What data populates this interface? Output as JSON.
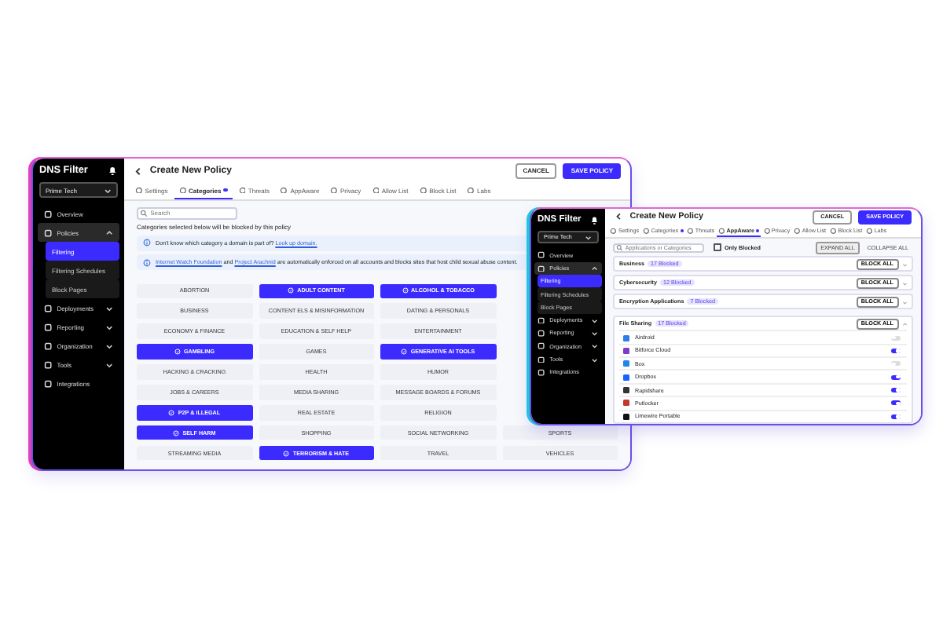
{
  "windows": [
    {
      "sidebar": {
        "logo": "DNS Filter",
        "org": "Prime Tech",
        "items": [
          {
            "label": "Overview",
            "selected": false
          },
          {
            "label": "Policies",
            "selected": false,
            "expanded": true,
            "children": [
              {
                "label": "Filtering",
                "selected": true
              },
              {
                "label": "Filtering Schedules",
                "selected": false
              },
              {
                "label": "Block Pages",
                "selected": false
              }
            ]
          },
          {
            "label": "Deployments",
            "selected": false,
            "expanded": false
          },
          {
            "label": "Reporting",
            "selected": false,
            "expanded": false
          },
          {
            "label": "Organization",
            "selected": false,
            "expanded": false
          },
          {
            "label": "Tools",
            "selected": false,
            "expanded": false
          },
          {
            "label": "Integrations",
            "selected": false
          }
        ]
      },
      "header": {
        "title": "Create New Policy",
        "buttons": [
          {
            "label": "CANCEL",
            "kind": "secondary"
          },
          {
            "label": "SAVE POLICY",
            "kind": "primary"
          }
        ]
      },
      "tabs": [
        {
          "label": "Settings",
          "selected": false,
          "dot": false
        },
        {
          "label": "Categories",
          "selected": true,
          "dot": true
        },
        {
          "label": "Threats",
          "selected": false,
          "dot": false
        },
        {
          "label": "AppAware",
          "selected": false,
          "dot": false
        },
        {
          "label": "Privacy",
          "selected": false,
          "dot": false
        },
        {
          "label": "Allow List",
          "selected": false,
          "dot": false
        },
        {
          "label": "Block List",
          "selected": false,
          "dot": false
        },
        {
          "label": "Labs",
          "selected": false,
          "dot": false
        }
      ],
      "body": {
        "kind": "categories",
        "search": {
          "placeholder": "Search"
        },
        "note": "Categories selected below will be blocked by this policy",
        "notices": [
          [
            {
              "text": "Don't know which category a domain is part of? ",
              "link": false
            },
            {
              "text": "Look up domain.",
              "link": true
            }
          ],
          [
            {
              "text": "Internet Watch Foundation",
              "link": true
            },
            {
              "text": " and ",
              "link": false
            },
            {
              "text": "Project Arachnid",
              "link": true
            },
            {
              "text": " are automatically enforced on all accounts and blocks sites that host child sexual abuse content.",
              "link": false
            }
          ]
        ],
        "category_rows": [
          [
            {
              "label": "ABORTION",
              "selected": false
            },
            {
              "label": "ADULT CONTENT",
              "selected": true
            },
            {
              "label": "ALCOHOL & TOBACCO",
              "selected": true
            }
          ],
          [
            {
              "label": "BUSINESS",
              "selected": false
            },
            {
              "label": "CONTENT ELS & MISINFORMATION",
              "selected": false
            },
            {
              "label": "DATING & PERSONALS",
              "selected": false
            }
          ],
          [
            {
              "label": "ECONOMY & FINANCE",
              "selected": false
            },
            {
              "label": "EDUCATION & SELF HELP",
              "selected": false
            },
            {
              "label": "ENTERTAINMENT",
              "selected": false
            }
          ],
          [
            {
              "label": "GAMBLING",
              "selected": true
            },
            {
              "label": "GAMES",
              "selected": false
            },
            {
              "label": "GENERATIVE AI TOOLS",
              "selected": true
            }
          ],
          [
            {
              "label": "HACKING & CRACKING",
              "selected": false
            },
            {
              "label": "HEALTH",
              "selected": false
            },
            {
              "label": "HUMOR",
              "selected": false
            }
          ],
          [
            {
              "label": "JOBS & CAREERS",
              "selected": false
            },
            {
              "label": "MEDIA SHARING",
              "selected": false
            },
            {
              "label": "MESSAGE BOARDS & FORUMS",
              "selected": false
            }
          ],
          [
            {
              "label": "P2P & ILLEGAL",
              "selected": true
            },
            {
              "label": "REAL ESTATE",
              "selected": false
            },
            {
              "label": "RELIGION",
              "selected": false
            }
          ],
          [
            {
              "label": "SELF HARM",
              "selected": true
            },
            {
              "label": "SHOPPING",
              "selected": false
            },
            {
              "label": "SOCIAL NETWORKING",
              "selected": false
            },
            {
              "label": "SPORTS",
              "selected": false
            }
          ],
          [
            {
              "label": "STREAMING MEDIA",
              "selected": false
            },
            {
              "label": "TERRORISM & HATE",
              "selected": true
            },
            {
              "label": "TRAVEL",
              "selected": false
            },
            {
              "label": "VEHICLES",
              "selected": false
            }
          ]
        ]
      }
    },
    {
      "sidebar": {
        "logo": "DNS Filter",
        "org": "Prime Tech",
        "items": [
          {
            "label": "Overview",
            "selected": false
          },
          {
            "label": "Policies",
            "selected": false,
            "expanded": true,
            "children": [
              {
                "label": "Filtering",
                "selected": true
              },
              {
                "label": "Filtering Schedules",
                "selected": false
              },
              {
                "label": "Block Pages",
                "selected": false
              }
            ]
          },
          {
            "label": "Deployments",
            "selected": false,
            "expanded": false
          },
          {
            "label": "Reporting",
            "selected": false,
            "expanded": false
          },
          {
            "label": "Organization",
            "selected": false,
            "expanded": false
          },
          {
            "label": "Tools",
            "selected": false,
            "expanded": false
          },
          {
            "label": "Integrations",
            "selected": false
          }
        ]
      },
      "header": {
        "title": "Create New Policy",
        "buttons": [
          {
            "label": "CANCEL",
            "kind": "secondary"
          },
          {
            "label": "SAVE POLICY",
            "kind": "primary"
          }
        ]
      },
      "tabs": [
        {
          "label": "Settings",
          "selected": false,
          "dot": false
        },
        {
          "label": "Categories",
          "selected": false,
          "dot": true
        },
        {
          "label": "Threats",
          "selected": false,
          "dot": false
        },
        {
          "label": "AppAware",
          "selected": true,
          "dot": true
        },
        {
          "label": "Privacy",
          "selected": false,
          "dot": false
        },
        {
          "label": "Allow List",
          "selected": false,
          "dot": false
        },
        {
          "label": "Block List",
          "selected": false,
          "dot": false
        },
        {
          "label": "Labs",
          "selected": false,
          "dot": false
        }
      ],
      "body": {
        "kind": "apps",
        "search": {
          "placeholder": "Applications or Categories"
        },
        "filter": {
          "label": "Only Blocked",
          "checked": false
        },
        "actions": [
          "EXPAND ALL",
          "COLLAPSE ALL"
        ],
        "groups": [
          {
            "name": "Business",
            "badge": "17 Blocked",
            "action": "BLOCK ALL",
            "expanded": false
          },
          {
            "name": "Cybersecurity",
            "badge": "12 Blocked",
            "action": "BLOCK ALL",
            "expanded": false
          },
          {
            "name": "Encryption Applications",
            "badge": "7 Blocked",
            "action": "BLOCK ALL",
            "expanded": false
          },
          {
            "name": "File Sharing",
            "badge": "17 Blocked",
            "action": "BLOCK ALL",
            "expanded": true,
            "apps": [
              {
                "name": "Airdroid",
                "on": false
              },
              {
                "name": "Bitforce Cloud",
                "on": true
              },
              {
                "name": "Box",
                "on": false
              },
              {
                "name": "Dropbox",
                "on": true
              },
              {
                "name": "Rapidshare",
                "on": true
              },
              {
                "name": "Putlocker",
                "on": true
              },
              {
                "name": "Limewire Portable",
                "on": true
              }
            ]
          }
        ]
      }
    }
  ]
}
